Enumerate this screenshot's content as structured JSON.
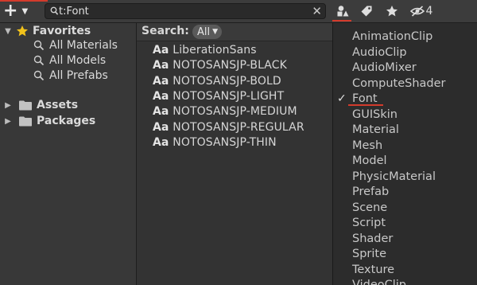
{
  "toolbar": {
    "add_icon": "plus-icon",
    "search": {
      "value": "t:Font"
    },
    "clear_label": "✕",
    "hidden_packages_count": "4"
  },
  "sidebar": {
    "favorites": {
      "label": "Favorites",
      "items": [
        {
          "label": "All Materials"
        },
        {
          "label": "All Models"
        },
        {
          "label": "All Prefabs"
        }
      ]
    },
    "assets": {
      "label": "Assets"
    },
    "packages": {
      "label": "Packages"
    }
  },
  "content": {
    "search_label": "Search:",
    "scope_value": "All",
    "results_prefix": "Aa",
    "results": [
      "LiberationSans",
      "NOTOSANSJP-BLACK",
      "NOTOSANSJP-BOLD",
      "NOTOSANSJP-LIGHT",
      "NOTOSANSJP-MEDIUM",
      "NOTOSANSJP-REGULAR",
      "NOTOSANSJP-THIN"
    ]
  },
  "type_dropdown": {
    "check_mark": "✓",
    "selected": "Font",
    "items": [
      "AnimationClip",
      "AudioClip",
      "AudioMixer",
      "ComputeShader",
      "Font",
      "GUISkin",
      "Material",
      "Mesh",
      "Model",
      "PhysicMaterial",
      "Prefab",
      "Scene",
      "Script",
      "Shader",
      "Sprite",
      "Texture",
      "VideoClip"
    ]
  },
  "colors": {
    "accent_red": "#d33b2c",
    "favorite_star": "#f1c21b"
  }
}
